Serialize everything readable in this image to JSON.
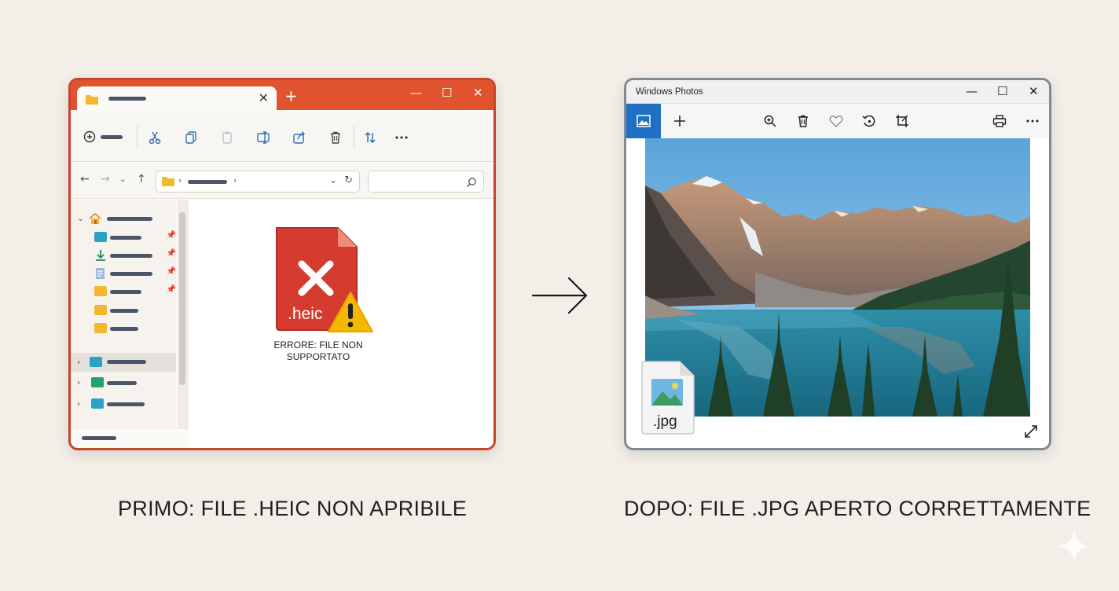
{
  "explorer": {
    "window": "file-explorer",
    "heic_file": {
      "extension": ".heic"
    },
    "error_message": "ERRORE: FILE NON SUPPORTATO",
    "toolbar_icons": [
      "new-icon",
      "cut-icon",
      "copy-icon",
      "paste-icon",
      "rename-icon",
      "share-icon",
      "delete-icon",
      "sort-icon",
      "more-icon"
    ],
    "sidebar_icons": [
      "home-icon",
      "desktop-icon",
      "downloads-icon",
      "documents-icon",
      "folder-icon",
      "folder-icon",
      "folder-icon",
      "this-pc-icon",
      "network-icon",
      "linux-icon"
    ]
  },
  "photos": {
    "title": "Windows Photos",
    "jpg_file": {
      "extension": ".jpg"
    },
    "toolbar_icons": [
      "gallery-icon",
      "add-icon",
      "zoom-icon",
      "delete-icon",
      "favorite-icon",
      "rotate-icon",
      "crop-icon",
      "print-icon",
      "more-icon"
    ]
  },
  "captions": {
    "before": "PRIMO: FILE .HEIC NON APRIBILE",
    "after": "DOPO: FILE .JPG APERTO CORRETTAMENTE"
  },
  "colors": {
    "explorer_accent": "#e0532f",
    "photos_accent": "#1f6fc2",
    "error_red": "#d63b2f",
    "warning_yellow": "#f5b800",
    "background": "#f3efe8"
  }
}
